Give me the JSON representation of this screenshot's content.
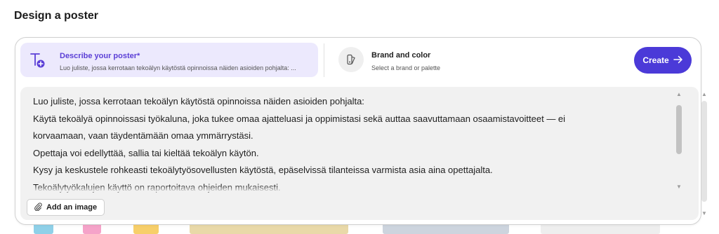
{
  "page": {
    "heading": "Design a poster"
  },
  "tabs": {
    "describe": {
      "title": "Describe your poster*",
      "subtitle": "Luo juliste, jossa kerrotaan tekoälyn käytöstä opinnoissa näiden asioiden pohjalta: ...",
      "icon": "text-sparkle-icon",
      "accent": "#5b3fd6",
      "background": "#ece9fd"
    },
    "brand": {
      "title": "Brand and color",
      "subtitle": "Select a brand or palette",
      "icon": "swatch-icon"
    }
  },
  "create_button": {
    "label": "Create",
    "icon": "arrow-right-icon",
    "color": "#4b3ad8"
  },
  "prompt": {
    "lines": [
      "Luo juliste, jossa kerrotaan tekoälyn käytöstä opinnoissa näiden asioiden pohjalta:",
      "Käytä tekoälyä opinnoissasi työkaluna, joka tukee omaa ajatteluasi ja oppimistasi sekä auttaa saavuttamaan osaamistavoitteet — ei",
      "korvaamaan, vaan täydentämään omaa ymmärrystäsi.",
      "Opettaja voi edellyttää, sallia tai kieltää tekoälyn käytön.",
      "Kysy ja keskustele rohkeasti tekoälytyösovellusten käytöstä, epäselvissä tilanteissa varmista asia aina opettajalta.",
      "Tekoälytyökalujen käyttö on raportoitava ohjeiden mukaisesti."
    ]
  },
  "add_image": {
    "label": "Add an image",
    "icon": "paperclip-icon"
  }
}
